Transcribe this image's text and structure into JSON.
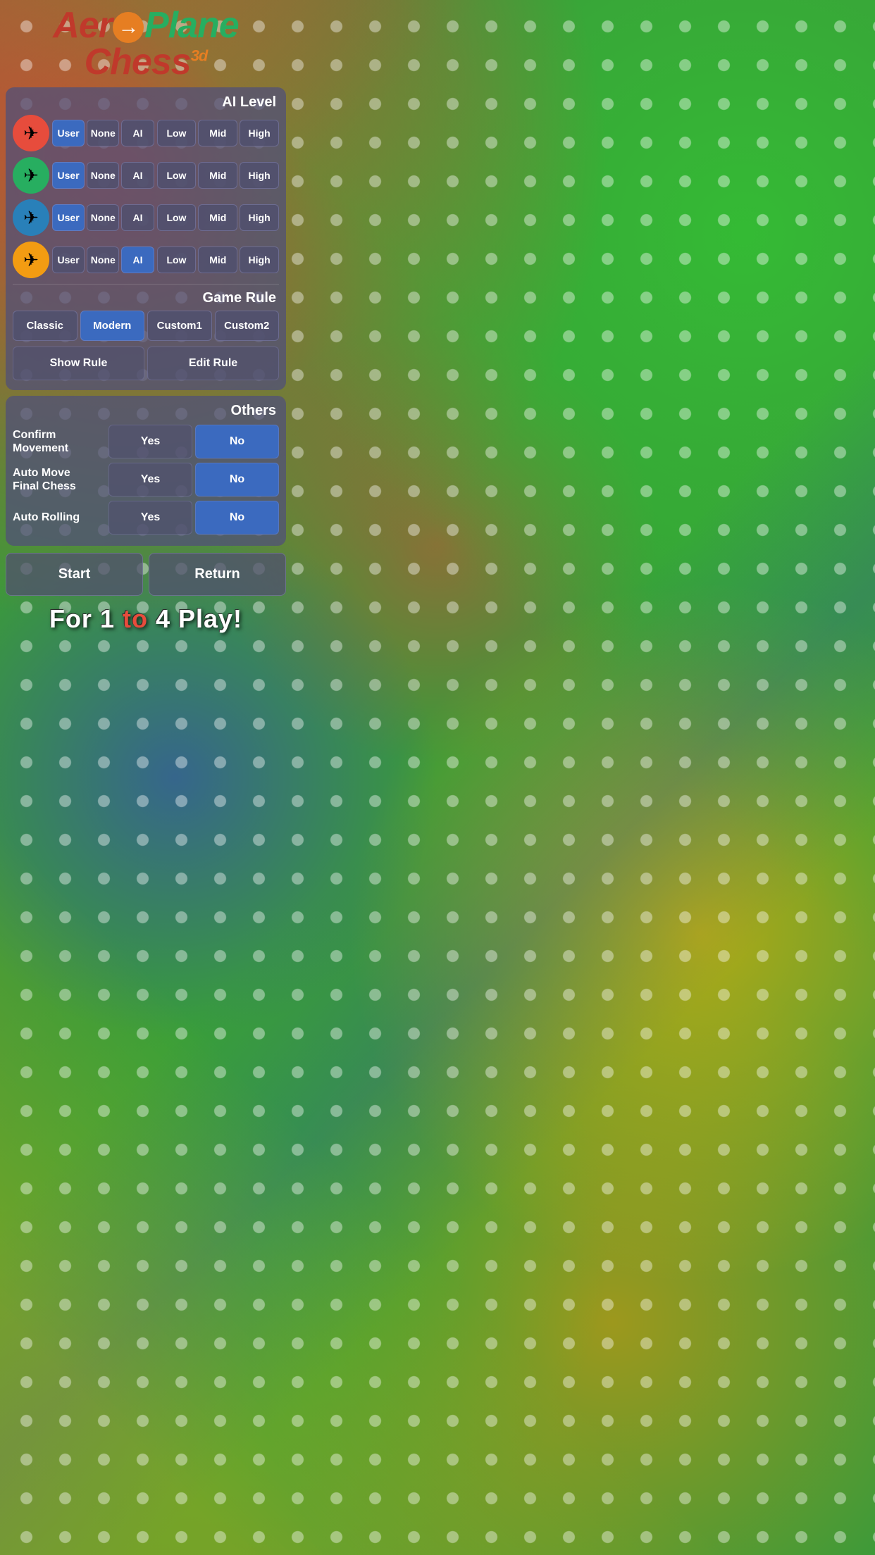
{
  "logo": {
    "aero": "Aer",
    "plane": "Plane",
    "chess": "Chess",
    "superscript": "3d",
    "arrow_symbol": "→"
  },
  "ai_level": {
    "section_label": "AI Level",
    "players": [
      {
        "color": "red",
        "emoji": "✈",
        "buttons": [
          "User",
          "None",
          "AI"
        ],
        "active_btn": "User",
        "level_buttons": [
          "Low",
          "Mid",
          "High"
        ],
        "active_level": "High"
      },
      {
        "color": "green",
        "emoji": "✈",
        "buttons": [
          "User",
          "None",
          "AI"
        ],
        "active_btn": "User",
        "level_buttons": [
          "Low",
          "Mid",
          "High"
        ],
        "active_level": "High"
      },
      {
        "color": "blue",
        "emoji": "✈",
        "buttons": [
          "User",
          "None",
          "AI"
        ],
        "active_btn": "User",
        "level_buttons": [
          "Low",
          "Mid",
          "High"
        ],
        "active_level": "High"
      },
      {
        "color": "yellow",
        "emoji": "✈",
        "buttons": [
          "User",
          "None",
          "AI"
        ],
        "active_btn": "AI",
        "level_buttons": [
          "Low",
          "Mid",
          "High"
        ],
        "active_level": "High"
      }
    ]
  },
  "game_rule": {
    "section_label": "Game Rule",
    "options": [
      "Classic",
      "Modern",
      "Custom1",
      "Custom2"
    ],
    "active": "Modern",
    "show_rule_label": "Show Rule",
    "edit_rule_label": "Edit Rule"
  },
  "others": {
    "section_label": "Others",
    "rows": [
      {
        "label": "Confirm Movement",
        "options": [
          "Yes",
          "No"
        ],
        "active": "No"
      },
      {
        "label": "Auto Move Final Chess",
        "options": [
          "Yes",
          "No"
        ],
        "active": "No"
      },
      {
        "label": "Auto Rolling",
        "options": [
          "Yes",
          "No"
        ],
        "active": "No"
      }
    ]
  },
  "actions": {
    "start_label": "Start",
    "return_label": "Return"
  },
  "footer": {
    "text_prefix": "For 1 ",
    "text_to": "to",
    "text_suffix": " 4 Play!"
  }
}
